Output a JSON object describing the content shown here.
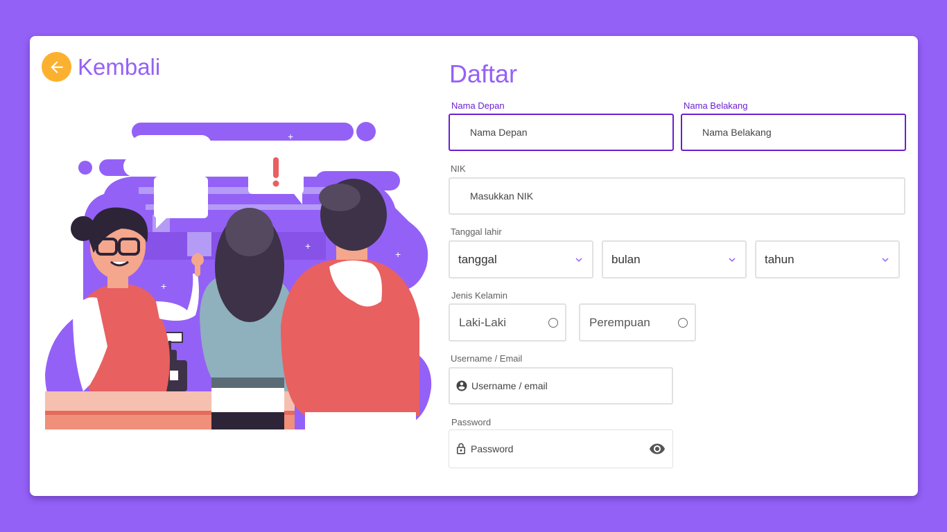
{
  "back": {
    "label": "Kembali",
    "icon": "arrow-left-icon"
  },
  "form": {
    "title": "Daftar",
    "first_name": {
      "label": "Nama Depan",
      "placeholder": "Nama Depan"
    },
    "last_name": {
      "label": "Nama Belakang",
      "placeholder": "Nama Belakang"
    },
    "nik": {
      "label": "NIK",
      "placeholder": "Masukkan NIK"
    },
    "birth": {
      "label": "Tanggal lahir",
      "day": "tanggal",
      "month": "bulan",
      "year": "tahun"
    },
    "gender": {
      "label": "Jenis Kelamin",
      "options": [
        "Laki-Laki",
        "Perempuan"
      ]
    },
    "username": {
      "label": "Username / Email",
      "placeholder": "Username / email",
      "icon": "account-circle-icon"
    },
    "password": {
      "label": "Password",
      "placeholder": "Password",
      "icon": "lock-icon",
      "toggle_icon": "eye-icon"
    }
  },
  "colors": {
    "background": "#9461f7",
    "accent": "#9461f7",
    "focus": "#6a1fd0",
    "back_button": "#fbb12f"
  },
  "illustration": {
    "name": "cashier-customers-illustration"
  }
}
